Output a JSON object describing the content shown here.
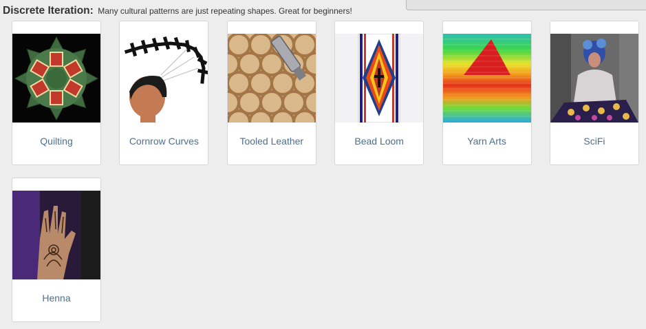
{
  "header": {
    "title": "Discrete Iteration:",
    "subtitle": "Many cultural patterns are just repeating shapes. Great for beginners!"
  },
  "cards": [
    {
      "label": "Quilting"
    },
    {
      "label": "Cornrow Curves"
    },
    {
      "label": "Tooled Leather"
    },
    {
      "label": "Bead Loom"
    },
    {
      "label": "Yarn Arts"
    },
    {
      "label": "SciFi"
    },
    {
      "label": "Henna"
    }
  ]
}
